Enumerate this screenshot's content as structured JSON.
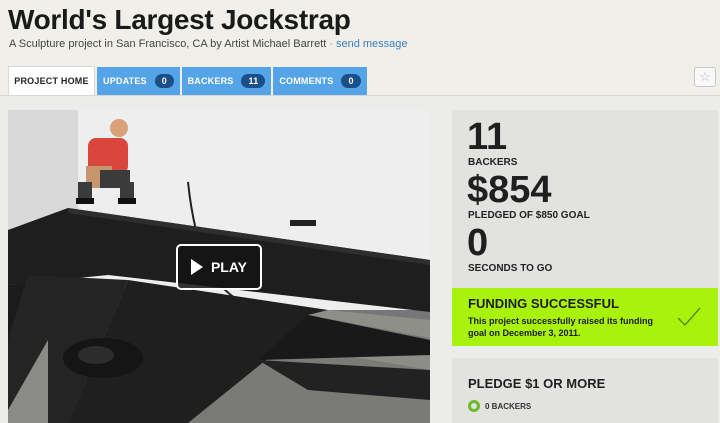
{
  "project": {
    "title": "World's Largest Jockstrap",
    "subtitle_text": "A Sculpture project in San Francisco, CA by Artist Michael Barrett",
    "separator": "·",
    "send_message_label": "send message"
  },
  "tabs": [
    {
      "label": "PROJECT HOME",
      "count": null,
      "active": true
    },
    {
      "label": "UPDATES",
      "count": "0",
      "active": false
    },
    {
      "label": "BACKERS",
      "count": "11",
      "active": false
    },
    {
      "label": "COMMENTS",
      "count": "0",
      "active": false
    }
  ],
  "star_icon": "star-icon",
  "video": {
    "play_label": "PLAY"
  },
  "stats": {
    "backers_value": "11",
    "backers_label": "BACKERS",
    "pledged_value": "$854",
    "pledged_label": "PLEDGED OF $850 GOAL",
    "time_value": "0",
    "time_label": "SECONDS TO GO"
  },
  "funding": {
    "status": "FUNDING SUCCESSFUL",
    "description": "This project successfully raised its funding goal on December 3, 2011.",
    "color": "#a8f20b"
  },
  "pledge": {
    "title": "PLEDGE $1 OR MORE",
    "backers_text": "0 BACKERS"
  },
  "colors": {
    "tab_blue": "#56a4e8",
    "link_blue": "#3c7fc0",
    "success_green": "#a8f20b"
  }
}
